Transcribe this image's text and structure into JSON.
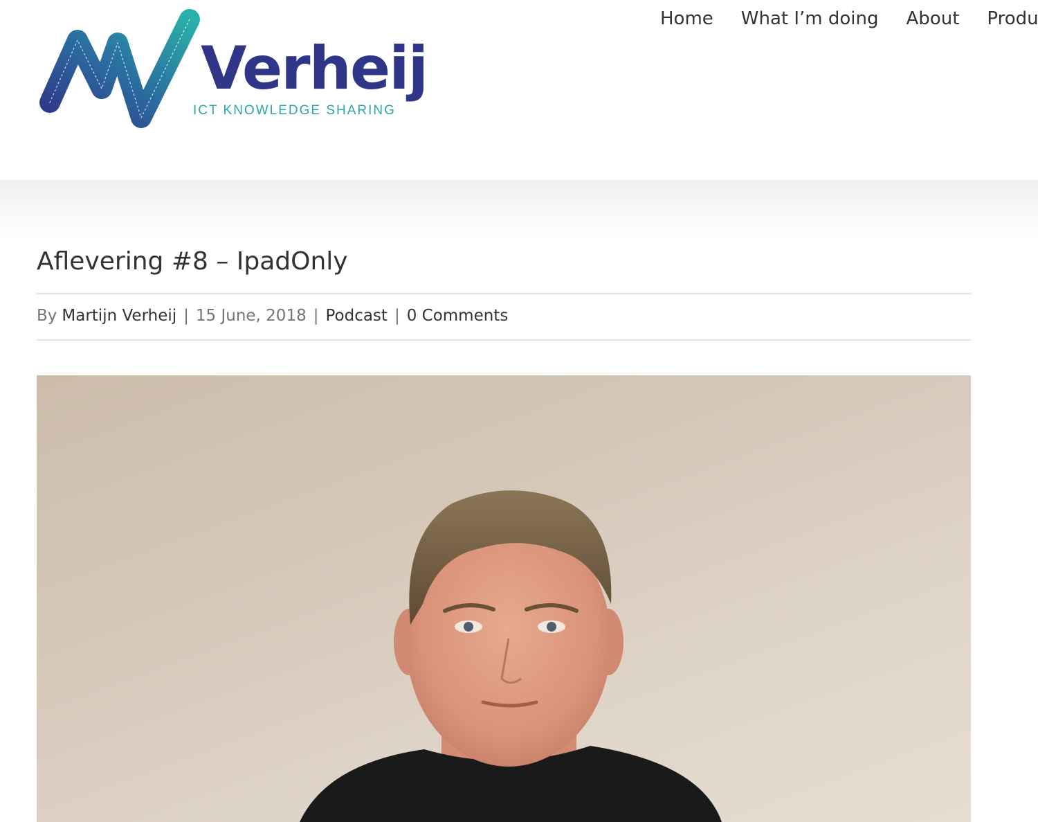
{
  "site": {
    "logo": {
      "wordmark": "Verheij",
      "tagline": "ICT KNOWLEDGE SHARING"
    },
    "nav": {
      "items": [
        {
          "label": "Home"
        },
        {
          "label": "What I’m doing"
        },
        {
          "label": "About"
        },
        {
          "label": "Product"
        }
      ]
    }
  },
  "post": {
    "title": "Aflevering #8 – IpadOnly",
    "meta": {
      "by_prefix": "By",
      "author": "Martijn Verheij",
      "separator": "|",
      "date": "15 June, 2018",
      "category": "Podcast",
      "comments": "0 Comments"
    }
  },
  "colors": {
    "brand_navy": "#2f3587",
    "brand_teal": "#2aa7a4",
    "text_dark": "#333333",
    "text_muted": "#747474",
    "rule": "#e2e2e2"
  }
}
